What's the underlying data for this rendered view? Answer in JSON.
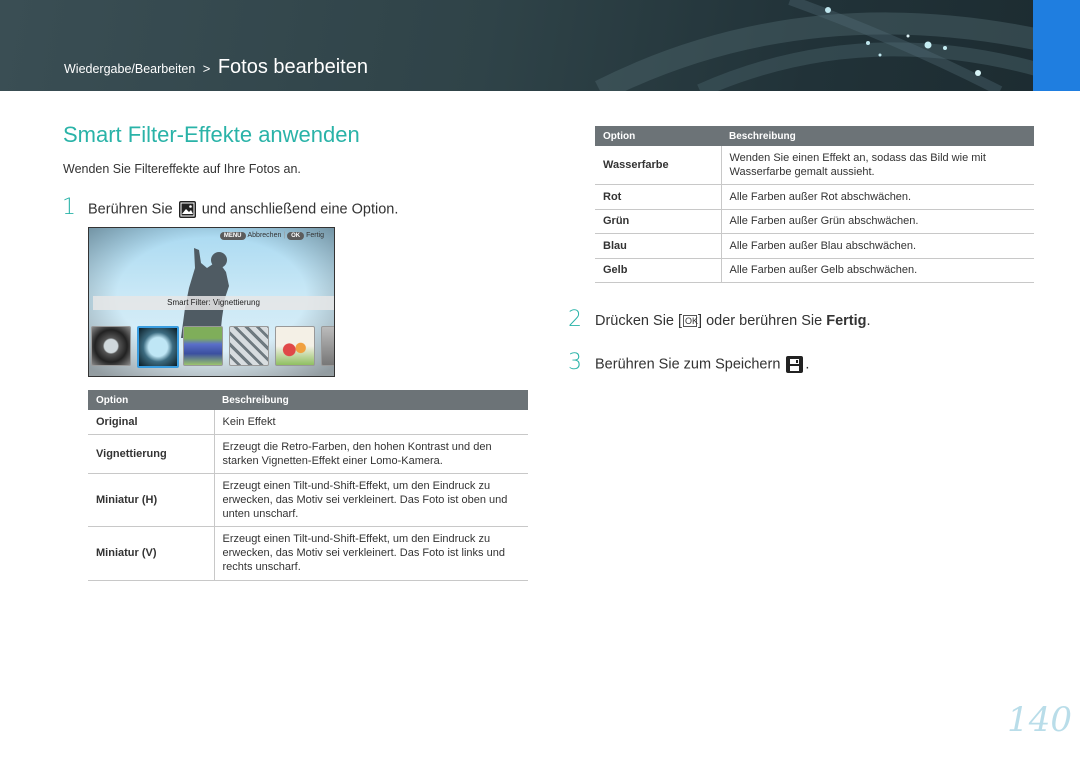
{
  "header": {
    "breadcrumb_parent": "Wiedergabe/Bearbeiten",
    "breadcrumb_sep": ">",
    "title": "Fotos bearbeiten",
    "accent_color": "#1f7ee0"
  },
  "section": {
    "title": "Smart Filter-Effekte anwenden",
    "intro": "Wenden Sie Filtereffekte auf Ihre Fotos an."
  },
  "steps": [
    {
      "num": "1",
      "before": "Berühren Sie",
      "after": "und anschließend eine Option.",
      "icon": "smart-filter-icon"
    },
    {
      "num": "2",
      "before": "Drücken Sie [",
      "key": "OK",
      "middle": "] oder berühren Sie ",
      "bold": "Fertig",
      "after": "."
    },
    {
      "num": "3",
      "before": "Berühren Sie zum Speichern",
      "icon": "save-icon",
      "after": "."
    }
  ],
  "camera_screen": {
    "menu_key": "MENU",
    "cancel_label": "Abbrechen",
    "ok_key": "OK",
    "done_label": "Fertig",
    "filter_label": "Smart Filter: Vignettierung",
    "thumbnails": [
      "original",
      "vignette",
      "miniature-h",
      "miniature-v",
      "watercolor",
      "red"
    ]
  },
  "left_table": {
    "headers": [
      "Option",
      "Beschreibung"
    ],
    "rows": [
      {
        "option": "Original",
        "desc": "Kein Effekt"
      },
      {
        "option": "Vignettierung",
        "desc": "Erzeugt die Retro-Farben, den hohen Kontrast und den starken Vignetten-Effekt einer Lomo-Kamera."
      },
      {
        "option": "Miniatur (H)",
        "desc": "Erzeugt einen Tilt-und-Shift-Effekt, um den Eindruck zu erwecken, das Motiv sei verkleinert. Das Foto ist oben und unten unscharf."
      },
      {
        "option": "Miniatur (V)",
        "desc": "Erzeugt einen Tilt-und-Shift-Effekt, um den Eindruck zu erwecken, das Motiv sei verkleinert. Das Foto ist links und rechts unscharf."
      }
    ]
  },
  "right_table": {
    "headers": [
      "Option",
      "Beschreibung"
    ],
    "rows": [
      {
        "option": "Wasserfarbe",
        "desc": "Wenden Sie einen Effekt an, sodass das Bild wie mit Wasserfarbe gemalt aussieht."
      },
      {
        "option": "Rot",
        "desc": "Alle Farben außer Rot abschwächen."
      },
      {
        "option": "Grün",
        "desc": "Alle Farben außer Grün abschwächen."
      },
      {
        "option": "Blau",
        "desc": "Alle Farben außer Blau abschwächen."
      },
      {
        "option": "Gelb",
        "desc": "Alle Farben außer Gelb abschwächen."
      }
    ]
  },
  "page_number": "140",
  "colors": {
    "title_teal": "#2ab3a8",
    "table_header": "#6c7377"
  }
}
